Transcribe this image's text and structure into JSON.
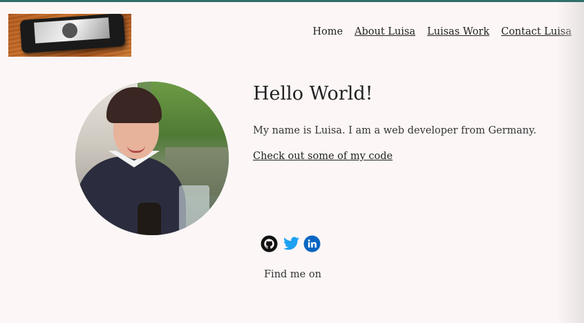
{
  "nav": {
    "items": [
      {
        "label": "Home",
        "underlined": false
      },
      {
        "label": "About Luisa",
        "underlined": true
      },
      {
        "label": "Luisas Work",
        "underlined": true
      },
      {
        "label": "Contact Luisa",
        "underlined": true
      }
    ]
  },
  "hero": {
    "title": "Hello World!",
    "description": "My name is Luisa. I am a web developer from Germany.",
    "code_link": "Check out some of my code"
  },
  "social": {
    "icons": [
      "github-icon",
      "twitter-icon",
      "linkedin-icon"
    ],
    "caption": "Find me on"
  },
  "colors": {
    "background": "#fdf6f6",
    "topbar": "#2f6f6a",
    "twitter": "#1da1f2",
    "linkedin": "#0a66c2",
    "text": "#222222"
  }
}
